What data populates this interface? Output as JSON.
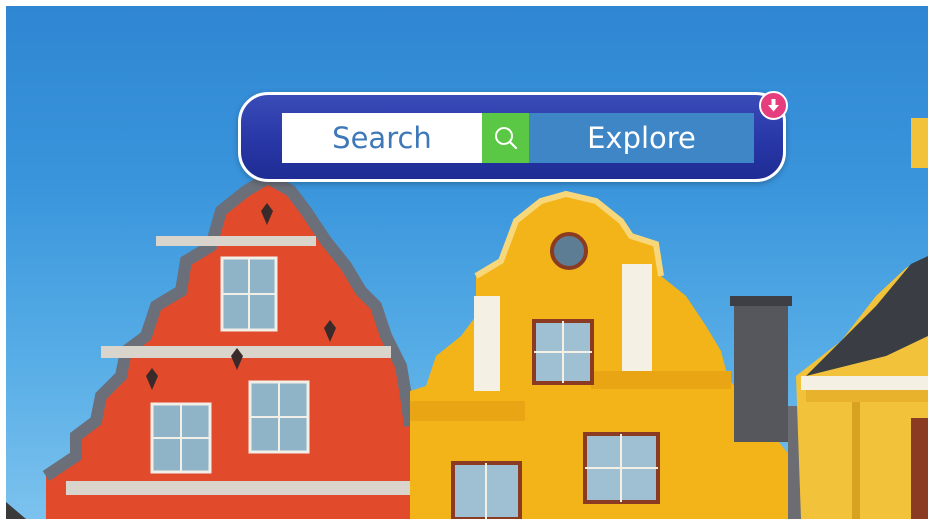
{
  "widget": {
    "search_label": "Search",
    "explore_label": "Explore",
    "search_icon": "search-icon",
    "badge_icon": "arrow-down-icon"
  },
  "colors": {
    "widget_bg": "#2737a6",
    "search_text": "#3e78b8",
    "search_icon_bg": "#5bc845",
    "explore_bg": "#3e86c6",
    "badge_bg": "#e63d7e"
  },
  "background": {
    "scene": "colorful-gabled-buildings-against-blue-sky"
  }
}
